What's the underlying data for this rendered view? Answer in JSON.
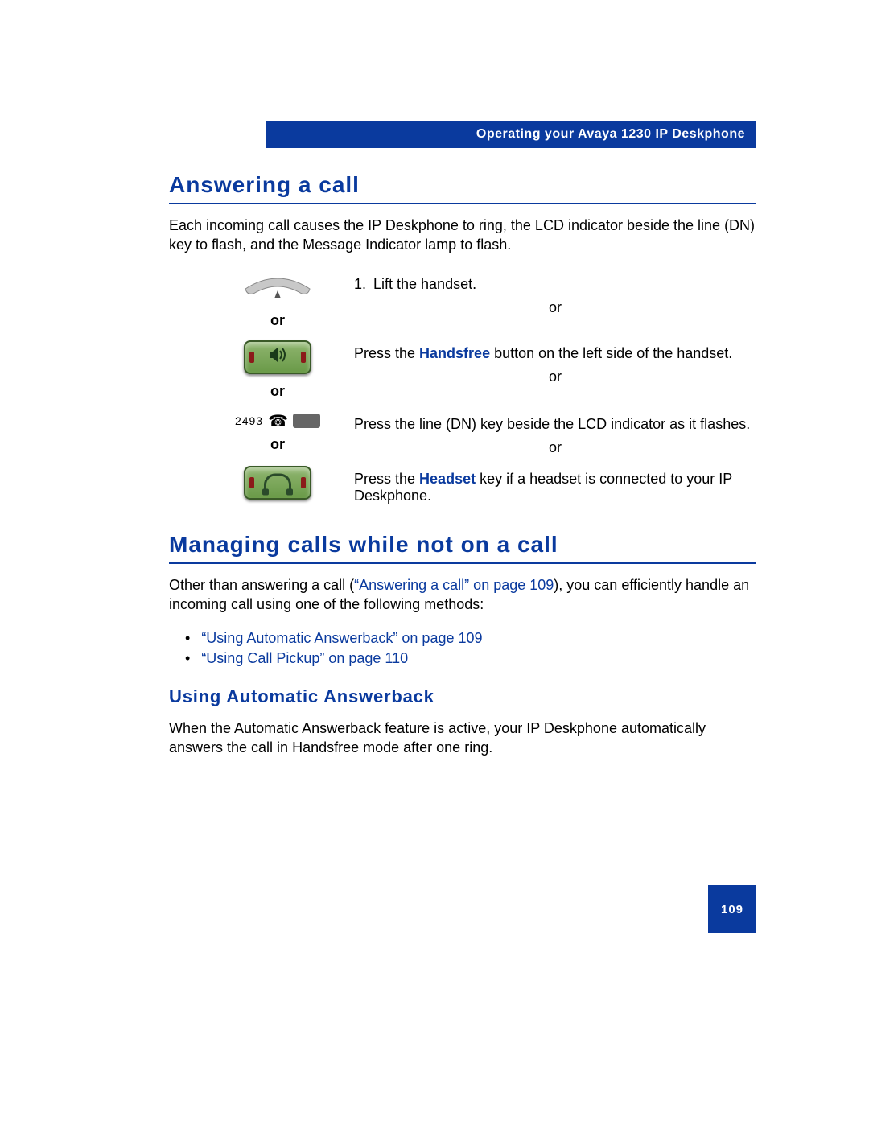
{
  "header": {
    "running_title": "Operating your Avaya 1230 IP Deskphone"
  },
  "section1": {
    "title": "Answering a call",
    "intro": "Each incoming call causes the IP Deskphone to ring, the LCD indicator beside the line (DN) key to flash, and the Message Indicator lamp to flash.",
    "step_number": "1.",
    "step1": "Lift the handset.",
    "or_text": "or",
    "step2_pre": "Press the ",
    "step2_bold": "Handsfree",
    "step2_post": " button on the left side of the handset.",
    "step3": "Press the line (DN) key beside the LCD indicator as it flashes.",
    "step4_pre": "Press the ",
    "step4_bold": "Headset",
    "step4_post": " key if a headset is connected to your IP Deskphone.",
    "dn_label": "2493"
  },
  "section2": {
    "title": "Managing calls while not on a call",
    "intro_pre": "Other than answering a call (",
    "intro_link": "“Answering a call” on page 109",
    "intro_post": "), you can efficiently handle an incoming call using one of the following methods:",
    "link1": "“Using Automatic Answerback” on page 109",
    "link2": "“Using Call Pickup” on page 110",
    "sub_title": "Using Automatic Answerback",
    "sub_body": "When the Automatic Answerback feature is active, your IP Deskphone automatically answers the call in Handsfree mode after one ring."
  },
  "page_number": "109"
}
